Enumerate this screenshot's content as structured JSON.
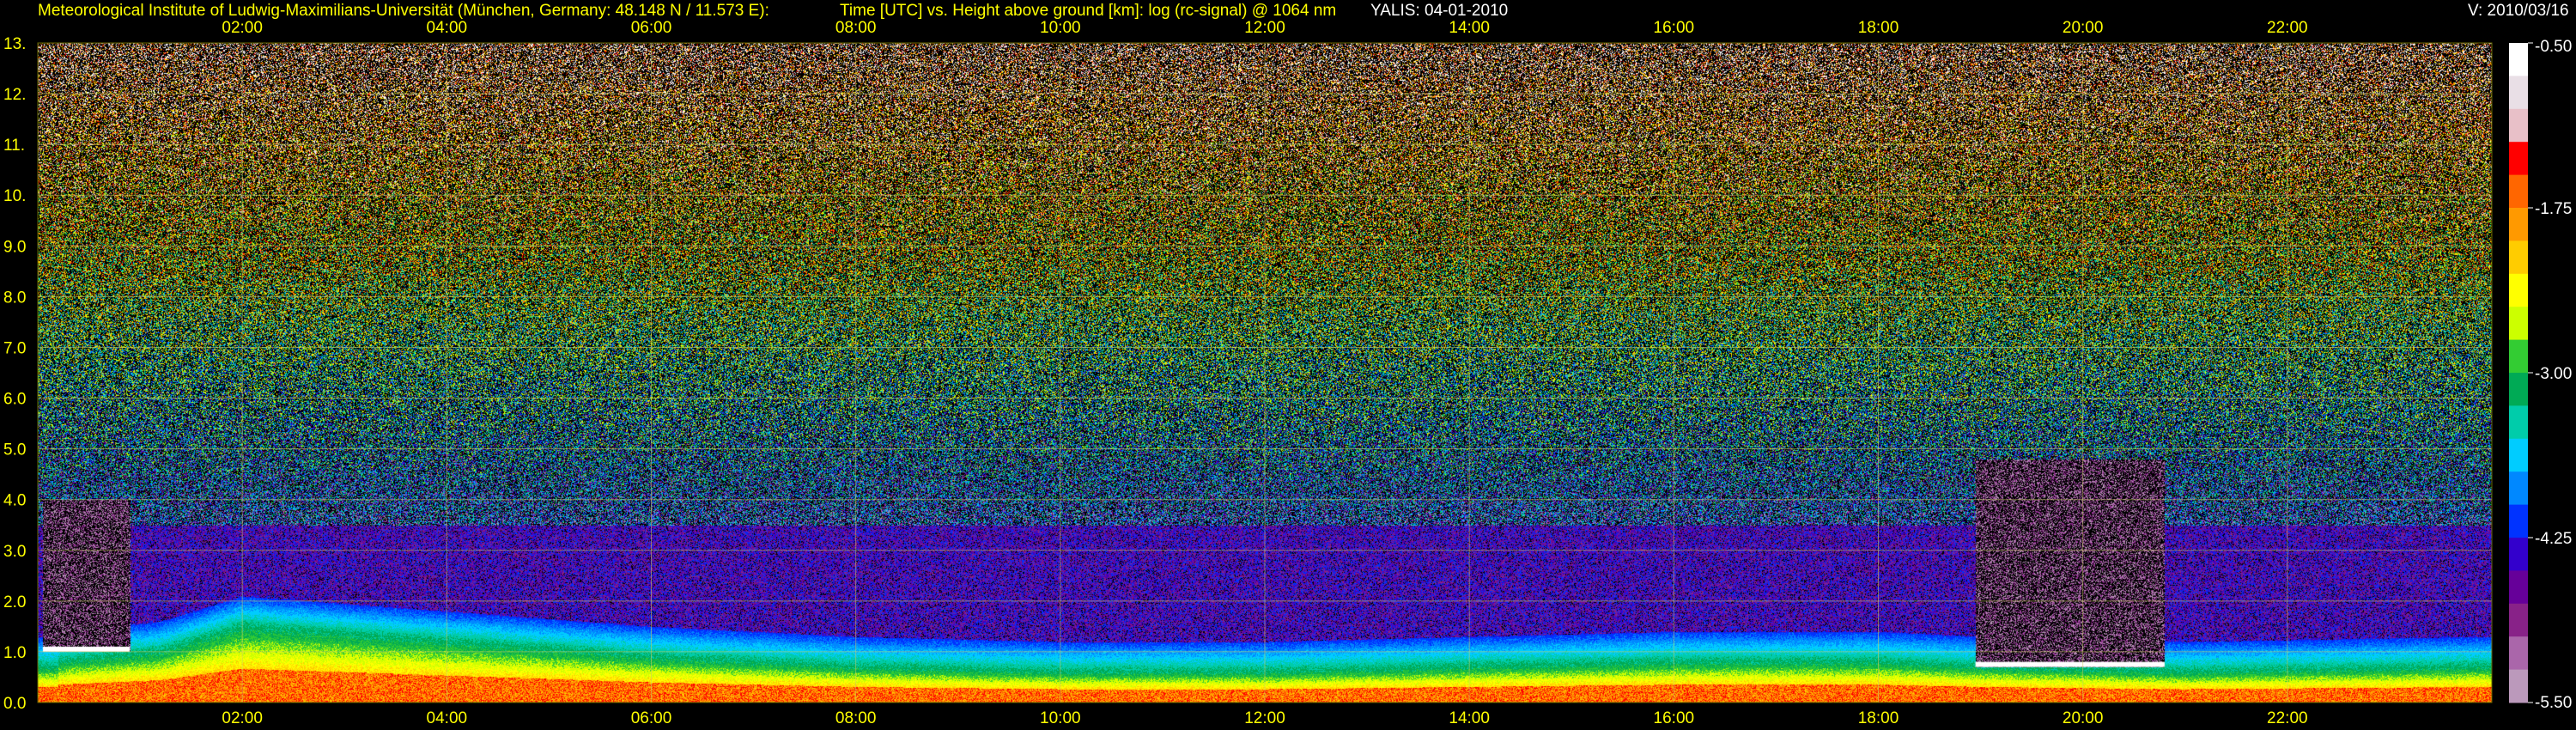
{
  "header": {
    "institute": "Meteorological Institute of Ludwig-Maximilians-Universität (München, Germany: 48.148 N / 11.573 E):",
    "plot_title": "Time [UTC] vs. Height above ground [km]: log (rc-signal) @ 1064 nm",
    "instrument_date": "YALIS: 04-01-2010",
    "version": "V: 2010/03/16"
  },
  "chart_data": {
    "type": "heatmap",
    "title": "Time [UTC] vs. Height above ground [km]: log (rc-signal) @ 1064 nm",
    "xlabel": "Time [UTC]",
    "ylabel": "Height above ground [km]",
    "xlim": [
      0,
      24
    ],
    "ylim": [
      0,
      13
    ],
    "x_ticks": [
      "02:00",
      "04:00",
      "06:00",
      "08:00",
      "10:00",
      "12:00",
      "14:00",
      "16:00",
      "18:00",
      "20:00",
      "22:00"
    ],
    "x_tick_values": [
      2,
      4,
      6,
      8,
      10,
      12,
      14,
      16,
      18,
      20,
      22
    ],
    "y_ticks": [
      "0.0",
      "1.0",
      "2.0",
      "3.0",
      "4.0",
      "5.0",
      "6.0",
      "7.0",
      "8.0",
      "9.0",
      "10.",
      "11.",
      "12.",
      "13."
    ],
    "y_tick_values": [
      0,
      1,
      2,
      3,
      4,
      5,
      6,
      7,
      8,
      9,
      10,
      11,
      12,
      13
    ],
    "colorbar": {
      "labels": [
        "-0.50",
        "-1.75",
        "-3.00",
        "-4.25",
        "-5.50"
      ],
      "values": [
        -0.5,
        -1.75,
        -3.0,
        -4.25,
        -5.5
      ],
      "range": [
        -5.5,
        -0.5
      ],
      "colors": [
        "#ffffff",
        "#e9dfe6",
        "#e8c0c8",
        "#ff0000",
        "#ff6600",
        "#ff9900",
        "#ffcc00",
        "#ffff00",
        "#ccff00",
        "#33cc33",
        "#00aa55",
        "#00ccaa",
        "#00ccff",
        "#0088ff",
        "#0033ff",
        "#3300cc",
        "#660099",
        "#882288",
        "#aa66aa",
        "#bb99bb"
      ]
    },
    "grid": true,
    "boundary_layer_top_km": [
      {
        "t": 0.2,
        "h": 0.8
      },
      {
        "t": 1.2,
        "h": 1.0
      },
      {
        "t": 2.0,
        "h": 1.5
      },
      {
        "t": 4.0,
        "h": 1.2
      },
      {
        "t": 6.0,
        "h": 0.9
      },
      {
        "t": 8.0,
        "h": 0.7
      },
      {
        "t": 10.0,
        "h": 0.6
      },
      {
        "t": 12.0,
        "h": 0.6
      },
      {
        "t": 14.0,
        "h": 0.7
      },
      {
        "t": 16.0,
        "h": 0.8
      },
      {
        "t": 18.0,
        "h": 0.8
      },
      {
        "t": 19.0,
        "h": 0.7
      },
      {
        "t": 21.0,
        "h": 0.6
      },
      {
        "t": 23.9,
        "h": 0.7
      }
    ],
    "cloud_layers": [
      {
        "t_start": 0.05,
        "t_end": 0.9,
        "h_bottom": 1.0,
        "h_top": 4.0
      },
      {
        "t_start": 18.95,
        "t_end": 20.8,
        "h_bottom": 0.7,
        "h_top": 4.8
      }
    ]
  }
}
